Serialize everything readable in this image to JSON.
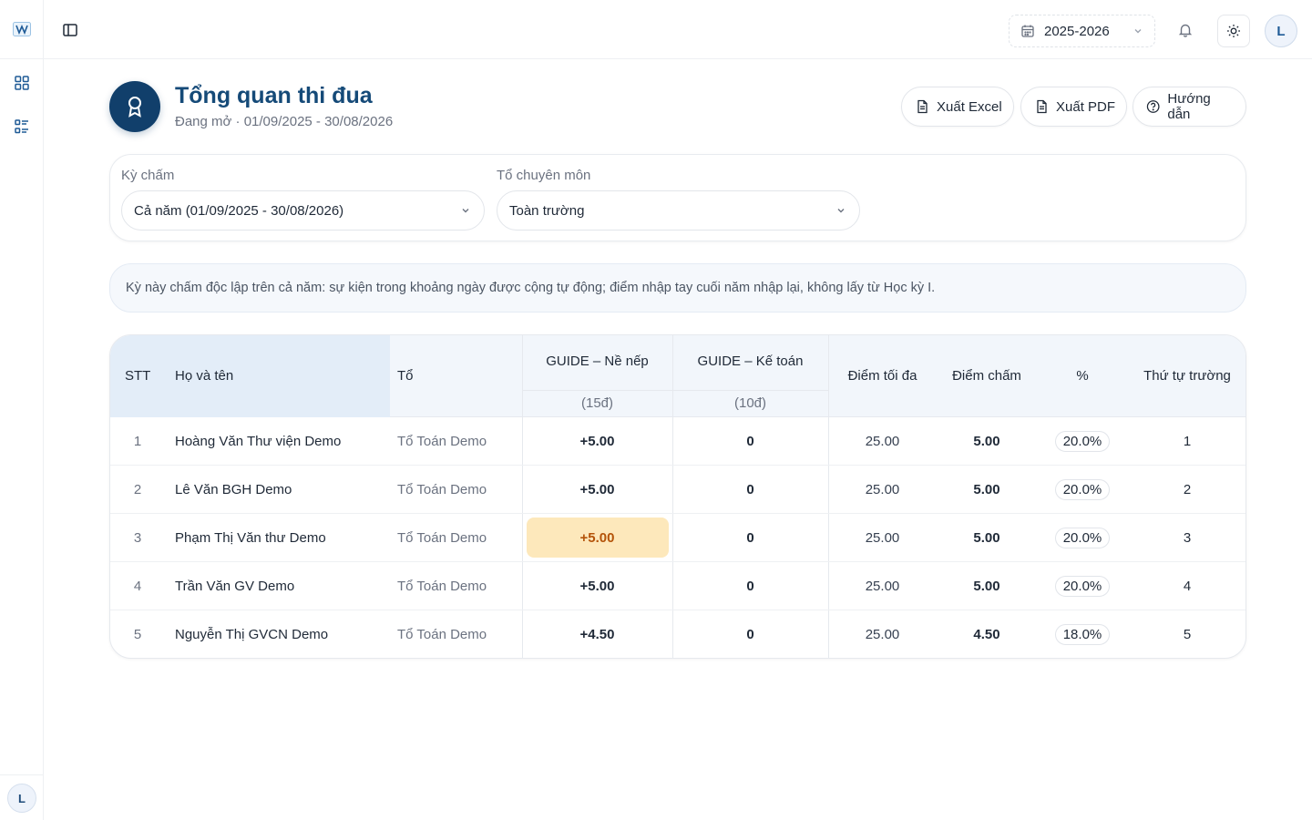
{
  "app": {
    "logo": "app-logo"
  },
  "rail": {
    "avatar_initial": "L"
  },
  "topbar": {
    "year": "2025-2026",
    "avatar_initial": "L"
  },
  "header": {
    "title": "Tổng quan thi đua",
    "subtitle": "Đang mở · 01/09/2025 - 30/08/2026",
    "buttons": {
      "excel": "Xuất Excel",
      "pdf": "Xuất PDF",
      "help": "Hướng dẫn"
    }
  },
  "filters": {
    "period_label": "Kỳ chấm",
    "period_value": "Cả năm (01/09/2025 - 30/08/2026)",
    "group_label": "Tổ chuyên môn",
    "group_value": "Toàn trường"
  },
  "note": "Kỳ này chấm độc lập trên cả năm: sự kiện trong khoảng ngày được cộng tự động; điểm nhập tay cuối năm nhập lại, không lấy từ Học kỳ I.",
  "table": {
    "headers": {
      "stt": "STT",
      "name": "Họ và tên",
      "to": "Tổ",
      "ne_nep": "GUIDE – Nề nếp",
      "ne_nep_sub": "(15đ)",
      "ke_toan": "GUIDE – Kế toán",
      "ke_toan_sub": "(10đ)",
      "max": "Điểm tối đa",
      "score": "Điểm chấm",
      "pct": "%",
      "rank": "Thứ tự trường"
    },
    "rows": [
      {
        "stt": "1",
        "name": "Hoàng Văn Thư viện Demo",
        "to": "Tổ Toán Demo",
        "ne_nep": "+5.00",
        "ke_toan": "0",
        "max": "25.00",
        "score": "5.00",
        "pct": "20.0%",
        "rank": "1"
      },
      {
        "stt": "2",
        "name": "Lê Văn BGH Demo",
        "to": "Tổ Toán Demo",
        "ne_nep": "+5.00",
        "ke_toan": "0",
        "max": "25.00",
        "score": "5.00",
        "pct": "20.0%",
        "rank": "2"
      },
      {
        "stt": "3",
        "name": "Phạm Thị Văn thư Demo",
        "to": "Tổ Toán Demo",
        "ne_nep": "+5.00",
        "ke_toan": "0",
        "max": "25.00",
        "score": "5.00",
        "pct": "20.0%",
        "rank": "3"
      },
      {
        "stt": "4",
        "name": "Trần Văn GV Demo",
        "to": "Tổ Toán Demo",
        "ne_nep": "+5.00",
        "ke_toan": "0",
        "max": "25.00",
        "score": "5.00",
        "pct": "20.0%",
        "rank": "4"
      },
      {
        "stt": "5",
        "name": "Nguyễn Thị GVCN Demo",
        "to": "Tổ Toán Demo",
        "ne_nep": "+4.50",
        "ke_toan": "0",
        "max": "25.00",
        "score": "4.50",
        "pct": "18.0%",
        "rank": "5"
      }
    ]
  },
  "colors": {
    "primary": "#113f6b",
    "title": "#154a78",
    "highlight": "#fde8bb"
  }
}
